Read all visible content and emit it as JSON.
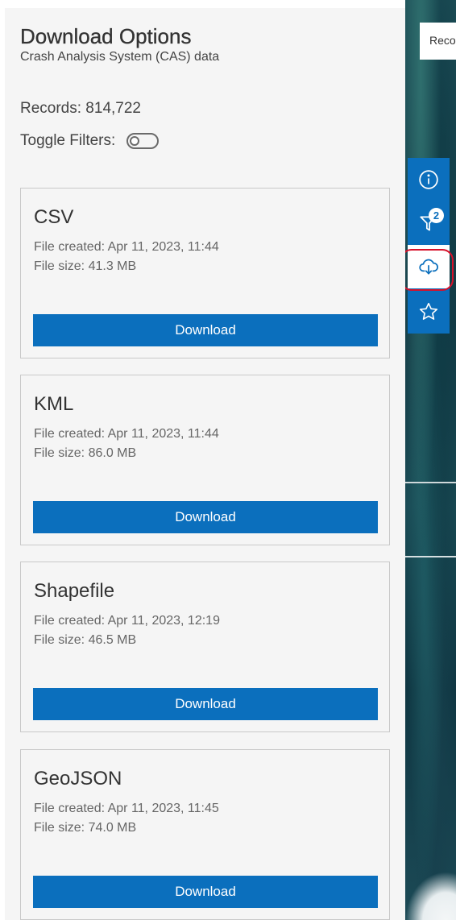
{
  "panel": {
    "title": "Download Options",
    "subtitle": "Crash Analysis System (CAS) data",
    "records_label": "Records: 814,722",
    "toggle_label": "Toggle Filters:",
    "toggle_on": false
  },
  "cards": [
    {
      "title": "CSV",
      "created": "File created: Apr 11, 2023, 11:44",
      "size": "File size: 41.3 MB",
      "button": "Download"
    },
    {
      "title": "KML",
      "created": "File created: Apr 11, 2023, 11:44",
      "size": "File size: 86.0 MB",
      "button": "Download"
    },
    {
      "title": "Shapefile",
      "created": "File created: Apr 11, 2023, 12:19",
      "size": "File size: 46.5 MB",
      "button": "Download"
    },
    {
      "title": "GeoJSON",
      "created": "File created: Apr 11, 2023, 11:45",
      "size": "File size: 74.0 MB",
      "button": "Download"
    }
  ],
  "toolbar": {
    "items": [
      {
        "icon": "info-icon"
      },
      {
        "icon": "filter-icon",
        "badge": "2"
      },
      {
        "icon": "cloud-download-icon",
        "active": true
      },
      {
        "icon": "star-icon"
      }
    ]
  },
  "map": {
    "records_chip": "Reco"
  },
  "colors": {
    "primary": "#0b6fbd",
    "panel_bg": "#f5f5f5",
    "highlight": "#d8102a"
  }
}
